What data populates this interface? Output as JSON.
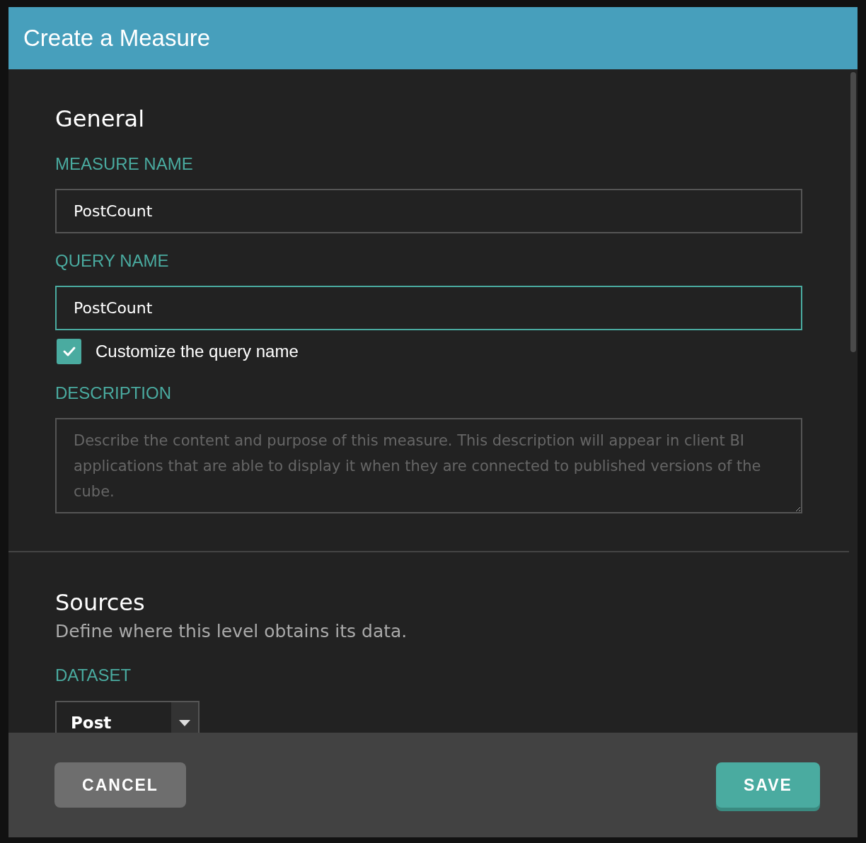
{
  "dialog": {
    "title": "Create a Measure"
  },
  "general": {
    "heading": "General",
    "measure_name": {
      "label": "MEASURE NAME",
      "value": "PostCount",
      "focused": false
    },
    "query_name": {
      "label": "QUERY NAME",
      "value": "PostCount",
      "focused": true
    },
    "customize_checkbox": {
      "label": "Customize the query name",
      "checked": true
    },
    "description": {
      "label": "DESCRIPTION",
      "placeholder": "Describe the content and purpose of this measure. This description will appear in client BI applications that are able to display it when they are connected to published versions of the cube."
    }
  },
  "sources": {
    "heading": "Sources",
    "subtitle": "Define where this level obtains its data.",
    "dataset": {
      "label": "DATASET",
      "value": "Post"
    }
  },
  "buttons": [
    {
      "label": "CANCEL",
      "kind": "secondary"
    },
    {
      "label": "SAVE",
      "kind": "primary"
    }
  ]
}
